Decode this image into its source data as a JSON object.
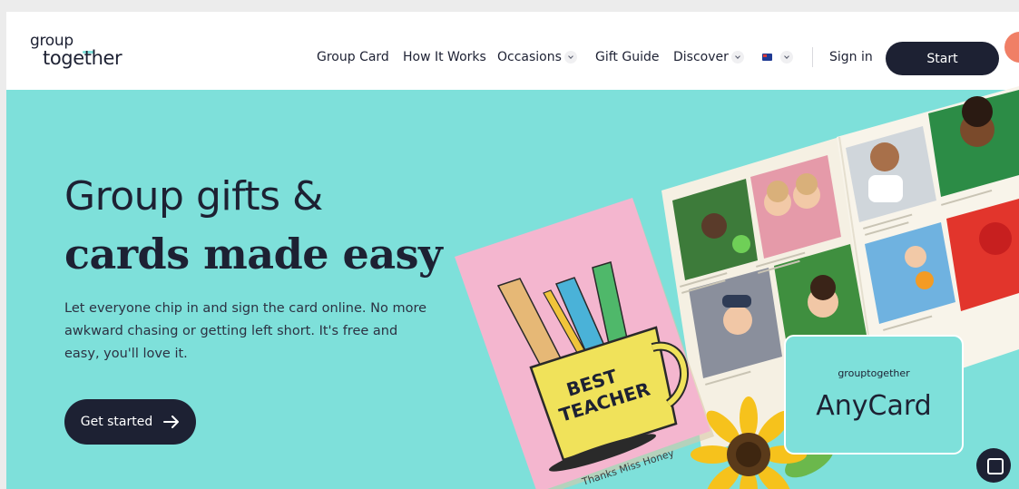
{
  "header": {
    "logo_line1": "group",
    "logo_line2": "together",
    "nav": [
      {
        "label": "Group Card",
        "dropdown": false
      },
      {
        "label": "How It Works",
        "dropdown": false
      },
      {
        "label": "Occasions",
        "dropdown": true
      },
      {
        "label": "Gift Guide",
        "dropdown": false
      },
      {
        "label": "Discover",
        "dropdown": true
      }
    ],
    "region": "Australia",
    "sign_in": "Sign in",
    "start": "Start"
  },
  "hero": {
    "title_line1": "Group gifts &",
    "title_line2": "cards made easy",
    "description": "Let everyone chip in and sign the card online. No more awkward chasing or getting left short. It's free and easy, you'll love it.",
    "cta": "Get started",
    "cta_icon": "arrow-right-icon"
  },
  "card": {
    "mug_line1": "BEST",
    "mug_line2": "TEACHER",
    "signature": "Thanks Miss Honey"
  },
  "anycard": {
    "brand": "grouptogether",
    "title": "AnyCard"
  },
  "colors": {
    "hero_bg": "#7ee0da",
    "dark": "#1d2133",
    "card_pink": "#f4b6cf",
    "mug_yellow": "#f0e25a",
    "accent_coral": "#f07f66"
  }
}
